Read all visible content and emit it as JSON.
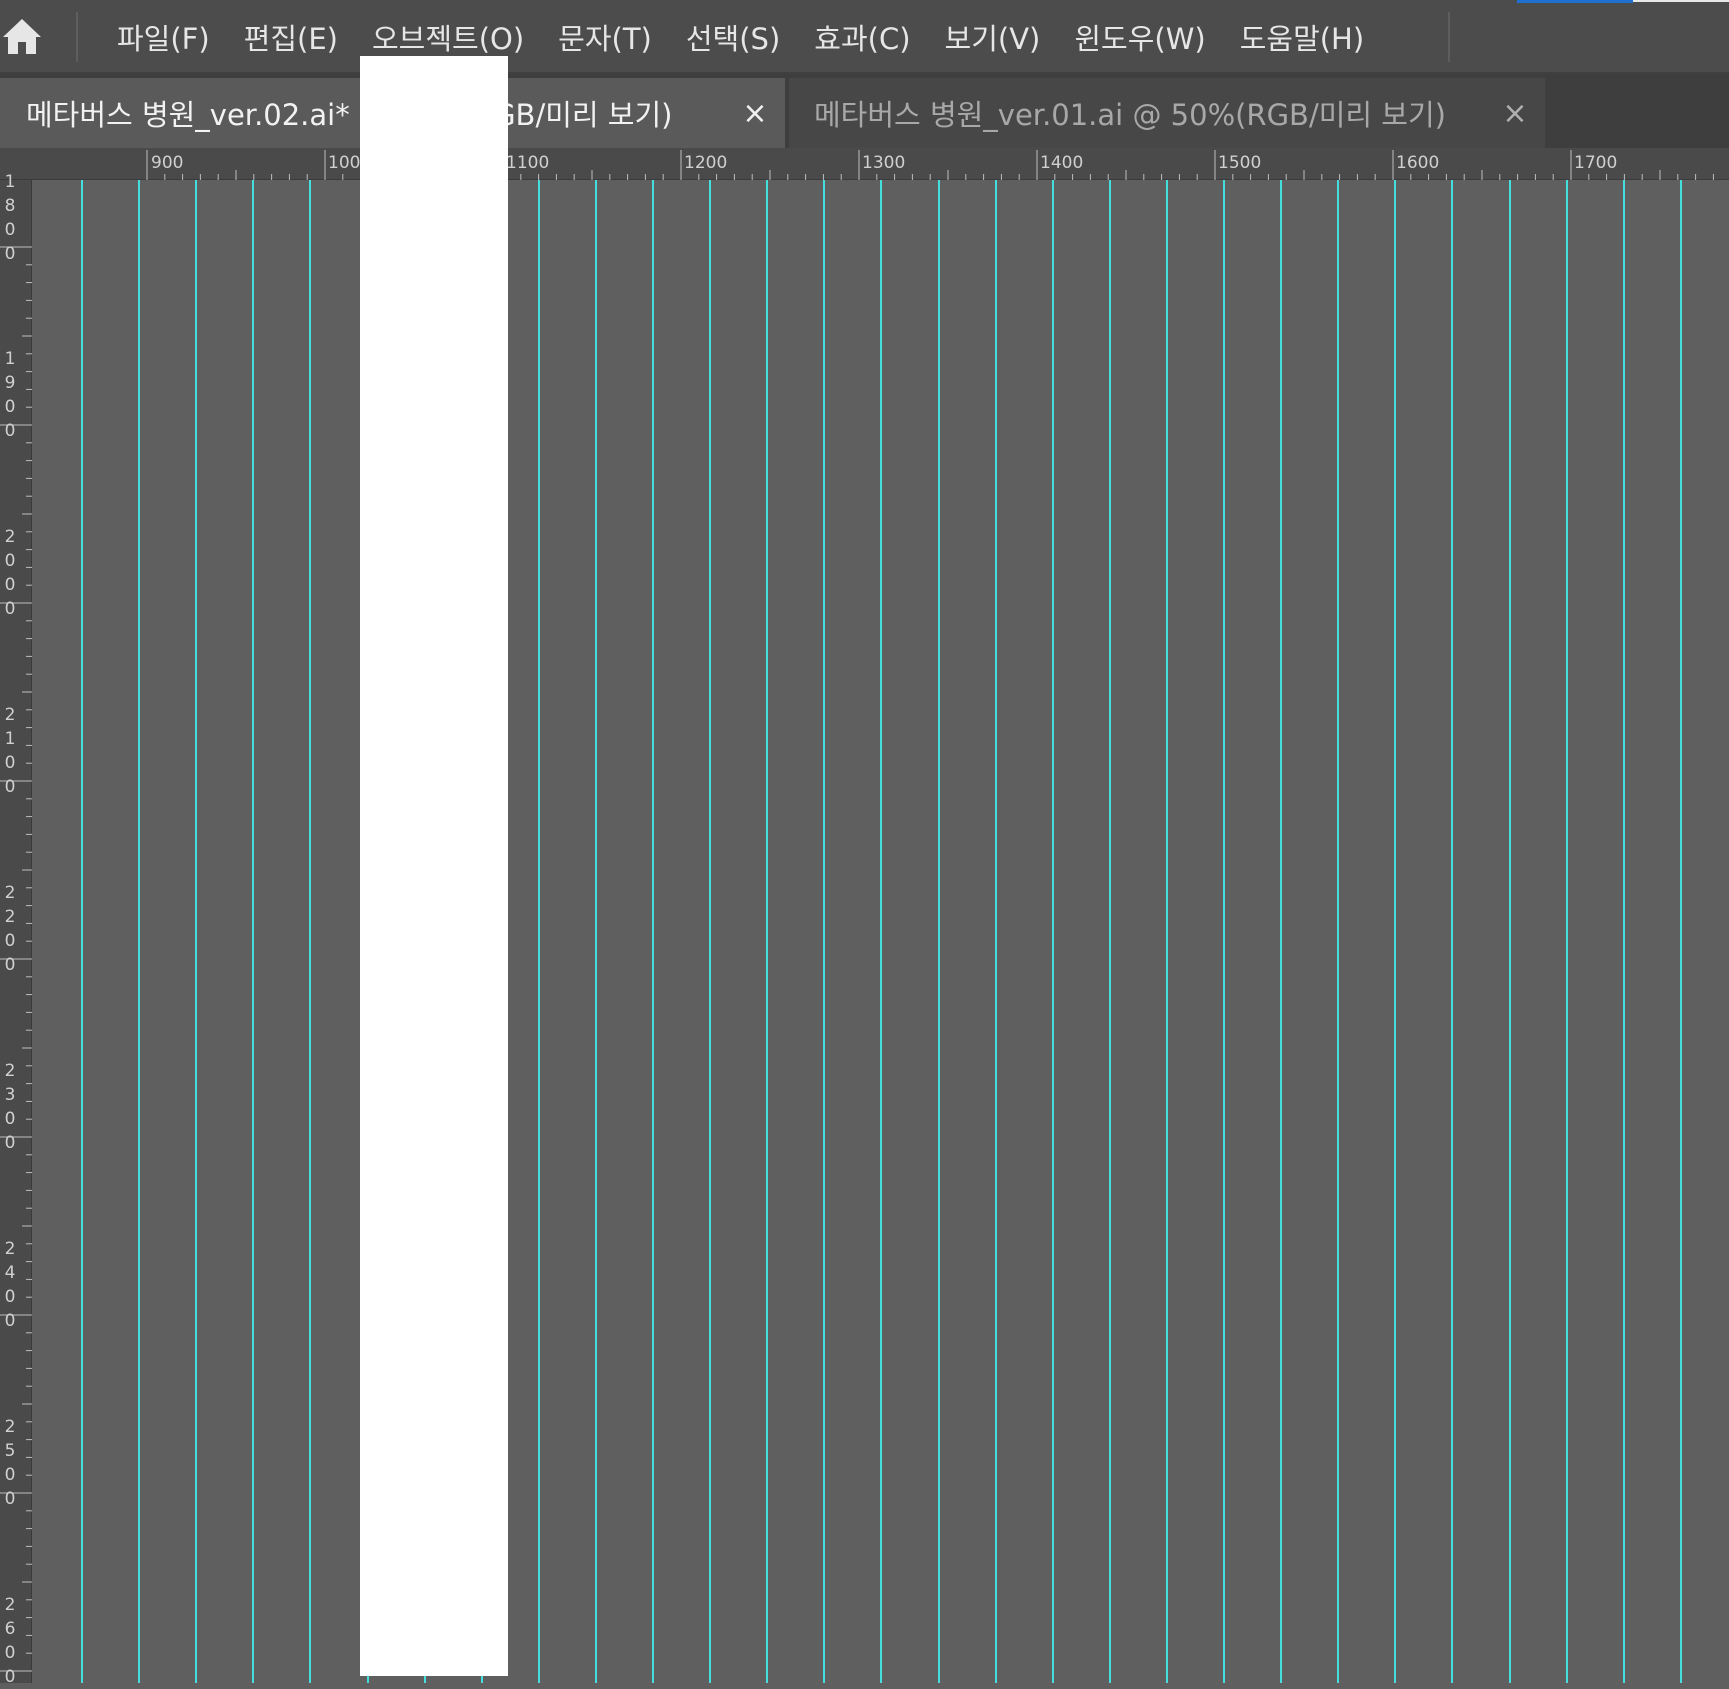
{
  "menubar": {
    "home_icon": "home-icon",
    "items": [
      {
        "label": "파일(F)"
      },
      {
        "label": "편집(E)"
      },
      {
        "label": "오브젝트(O)"
      },
      {
        "label": "문자(T)"
      },
      {
        "label": "선택(S)"
      },
      {
        "label": "효과(C)"
      },
      {
        "label": "보기(V)"
      },
      {
        "label": "윈도우(W)"
      },
      {
        "label": "도움말(H)"
      }
    ],
    "accent_color": "#1f6fcf"
  },
  "tabs": [
    {
      "title": "메타버스  병원_ver.02.ai* @ 50%(RGB/미리  보기)",
      "close": "×",
      "active": true
    },
    {
      "title": "메타버스  병원_ver.01.ai  @  50%(RGB/미리  보기)",
      "close": "×",
      "active": false
    }
  ],
  "ruler_h": {
    "labels": [
      "900",
      "100",
      "1100",
      "1200",
      "1300",
      "1400",
      "1500",
      "1600",
      "1700"
    ]
  },
  "ruler_v": {
    "labels": [
      "1800",
      "1900",
      "2000",
      "2100",
      "2200",
      "2300",
      "2400",
      "2500",
      "2600"
    ]
  },
  "canvas": {
    "background": "#5f5f5f",
    "guide_color": "#44dede",
    "guide_count": 29
  }
}
